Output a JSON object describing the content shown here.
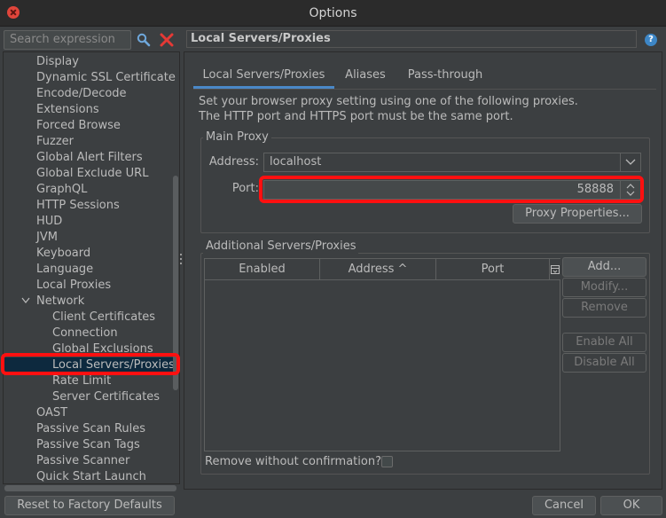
{
  "window": {
    "title": "Options"
  },
  "sidebar": {
    "search_placeholder": "Search expression",
    "items": [
      {
        "label": "Display",
        "level": 1
      },
      {
        "label": "Dynamic SSL Certificate",
        "level": 1
      },
      {
        "label": "Encode/Decode",
        "level": 1
      },
      {
        "label": "Extensions",
        "level": 1
      },
      {
        "label": "Forced Browse",
        "level": 1
      },
      {
        "label": "Fuzzer",
        "level": 1
      },
      {
        "label": "Global Alert Filters",
        "level": 1
      },
      {
        "label": "Global Exclude URL",
        "level": 1
      },
      {
        "label": "GraphQL",
        "level": 1
      },
      {
        "label": "HTTP Sessions",
        "level": 1
      },
      {
        "label": "HUD",
        "level": 1
      },
      {
        "label": "JVM",
        "level": 1
      },
      {
        "label": "Keyboard",
        "level": 1
      },
      {
        "label": "Language",
        "level": 1
      },
      {
        "label": "Local Proxies",
        "level": 1
      },
      {
        "label": "Network",
        "level": 1,
        "expanded": true
      },
      {
        "label": "Client Certificates",
        "level": 2
      },
      {
        "label": "Connection",
        "level": 2
      },
      {
        "label": "Global Exclusions",
        "level": 2
      },
      {
        "label": "Local Servers/Proxies",
        "level": 2,
        "selected": true
      },
      {
        "label": "Rate Limit",
        "level": 2
      },
      {
        "label": "Server Certificates",
        "level": 2
      },
      {
        "label": "OAST",
        "level": 1
      },
      {
        "label": "Passive Scan Rules",
        "level": 1
      },
      {
        "label": "Passive Scan Tags",
        "level": 1
      },
      {
        "label": "Passive Scanner",
        "level": 1
      },
      {
        "label": "Quick Start Launch",
        "level": 1
      }
    ]
  },
  "panel": {
    "title": "Local Servers/Proxies",
    "help": "?",
    "tabs": [
      "Local Servers/Proxies",
      "Aliases",
      "Pass-through"
    ],
    "description": [
      "Set your browser proxy setting using one of the following proxies.",
      "The HTTP port and HTTPS port must be the same port."
    ],
    "main_proxy": {
      "label": "Main Proxy",
      "address_label": "Address:",
      "address_value": "localhost",
      "port_label": "Port:",
      "port_value": "58888",
      "proxy_properties_button": "Proxy Properties..."
    },
    "additional": {
      "label": "Additional Servers/Proxies",
      "columns": [
        "Enabled",
        "Address ^",
        "Port"
      ],
      "buttons": {
        "add": "Add...",
        "modify": "Modify...",
        "remove": "Remove",
        "enable_all": "Enable All",
        "disable_all": "Disable All"
      },
      "remove_without_confirmation": "Remove without confirmation?"
    }
  },
  "footer": {
    "reset": "Reset to Factory Defaults",
    "cancel": "Cancel",
    "ok": "OK"
  },
  "colors": {
    "highlight": "#ff1010",
    "selection": "#0d293e",
    "accent": "#4a88c7"
  }
}
